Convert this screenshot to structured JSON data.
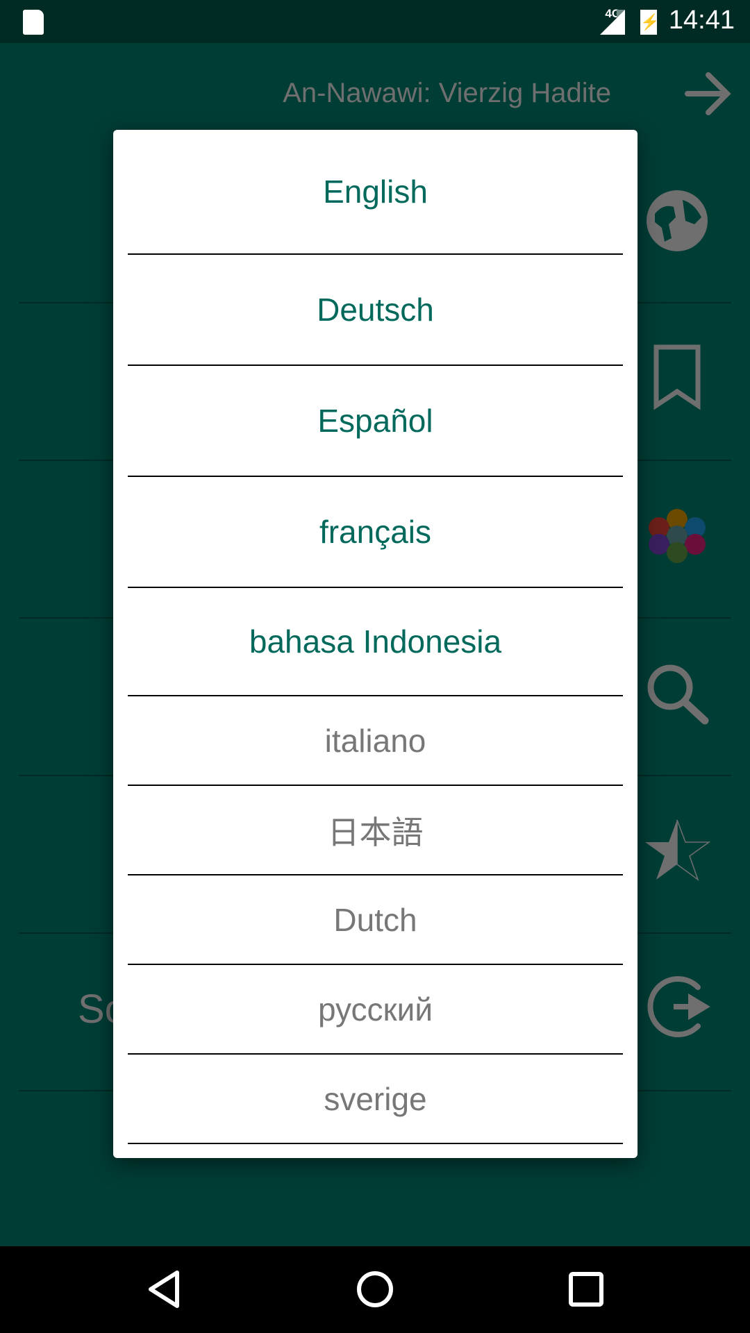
{
  "status_bar": {
    "network": "4G",
    "time": "14:41",
    "icons": [
      "sd-card-icon",
      "signal-icon",
      "battery-charging-icon"
    ]
  },
  "app": {
    "title": "An-Nawawi: Vierzig Hadite",
    "partial_menu_text": "So",
    "side_icons": [
      "globe-icon",
      "bookmark-icon",
      "hexagon-colors-icon",
      "search-icon",
      "half-star-icon",
      "logout-icon"
    ]
  },
  "dialog": {
    "items": [
      {
        "label": "English",
        "enabled": true
      },
      {
        "label": "Deutsch",
        "enabled": true
      },
      {
        "label": "Español",
        "enabled": true
      },
      {
        "label": "français",
        "enabled": true
      },
      {
        "label": "bahasa Indonesia",
        "enabled": true
      },
      {
        "label": "italiano",
        "enabled": false
      },
      {
        "label": "日本語",
        "enabled": false
      },
      {
        "label": "Dutch",
        "enabled": false
      },
      {
        "label": "русский",
        "enabled": false
      },
      {
        "label": "sverige",
        "enabled": false
      }
    ]
  },
  "colors": {
    "accent": "#00695c",
    "disabled": "#777777",
    "app_bg": "#003d35"
  },
  "nav": [
    "back-icon",
    "home-icon",
    "recents-icon"
  ]
}
